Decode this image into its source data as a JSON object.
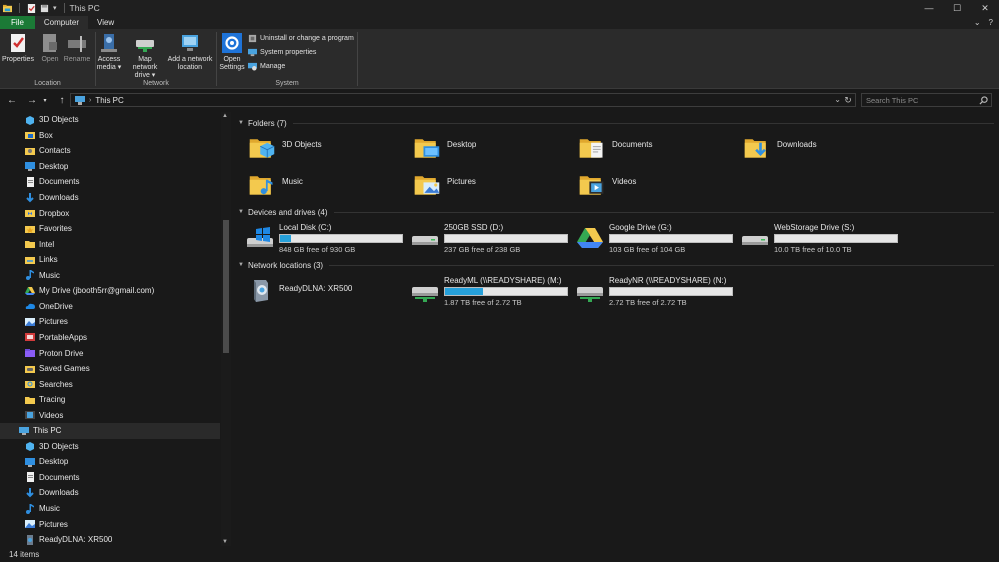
{
  "window": {
    "title": "This PC",
    "controls": {
      "minimize": "—",
      "maximize": "☐",
      "close": "✕"
    }
  },
  "ribbon_tabs": [
    {
      "label": "File"
    },
    {
      "label": "Computer"
    },
    {
      "label": "View"
    }
  ],
  "ribbon": {
    "location": {
      "label": "Location",
      "buttons": [
        {
          "label": "Properties",
          "icon": "properties-icon"
        },
        {
          "label": "Open",
          "icon": "open-icon"
        },
        {
          "label": "Rename",
          "icon": "rename-icon"
        }
      ]
    },
    "network": {
      "label": "Network",
      "buttons": [
        {
          "label": "Access media ▾",
          "icon": "media-icon"
        },
        {
          "label": "Map network drive ▾",
          "icon": "network-drive-icon"
        },
        {
          "label": "Add a network location",
          "icon": "network-location-icon"
        }
      ]
    },
    "system": {
      "label": "System",
      "open_settings": "Open Settings",
      "items": [
        {
          "label": "Uninstall or change a program"
        },
        {
          "label": "System properties"
        },
        {
          "label": "Manage"
        }
      ]
    }
  },
  "address": {
    "path": "This PC",
    "search_placeholder": "Search This PC"
  },
  "navpane": {
    "items": [
      {
        "label": "3D Objects",
        "icon": "3d-objects-icon",
        "indent": 1
      },
      {
        "label": "Box",
        "icon": "box-icon",
        "indent": 1
      },
      {
        "label": "Contacts",
        "icon": "contacts-icon",
        "indent": 1
      },
      {
        "label": "Desktop",
        "icon": "desktop-icon",
        "indent": 1
      },
      {
        "label": "Documents",
        "icon": "documents-icon",
        "indent": 1
      },
      {
        "label": "Downloads",
        "icon": "downloads-icon",
        "indent": 1
      },
      {
        "label": "Dropbox",
        "icon": "dropbox-icon",
        "indent": 1
      },
      {
        "label": "Favorites",
        "icon": "favorites-icon",
        "indent": 1
      },
      {
        "label": "Intel",
        "icon": "folder-icon",
        "indent": 1
      },
      {
        "label": "Links",
        "icon": "links-icon",
        "indent": 1
      },
      {
        "label": "Music",
        "icon": "music-icon",
        "indent": 1
      },
      {
        "label": "My Drive (jbooth5rr@gmail.com)",
        "icon": "google-drive-icon",
        "indent": 1
      },
      {
        "label": "OneDrive",
        "icon": "onedrive-icon",
        "indent": 1
      },
      {
        "label": "Pictures",
        "icon": "pictures-icon",
        "indent": 1
      },
      {
        "label": "PortableApps",
        "icon": "portableapps-icon",
        "indent": 1
      },
      {
        "label": "Proton Drive",
        "icon": "proton-drive-icon",
        "indent": 1
      },
      {
        "label": "Saved Games",
        "icon": "saved-games-icon",
        "indent": 1
      },
      {
        "label": "Searches",
        "icon": "searches-icon",
        "indent": 1
      },
      {
        "label": "Tracing",
        "icon": "folder-icon",
        "indent": 1
      },
      {
        "label": "Videos",
        "icon": "videos-icon",
        "indent": 1
      },
      {
        "label": "This PC",
        "icon": "this-pc-icon",
        "indent": 0,
        "selected": true
      },
      {
        "label": "3D Objects",
        "icon": "3d-objects-icon",
        "indent": 1
      },
      {
        "label": "Desktop",
        "icon": "desktop-icon",
        "indent": 1
      },
      {
        "label": "Documents",
        "icon": "documents-icon",
        "indent": 1
      },
      {
        "label": "Downloads",
        "icon": "downloads-icon",
        "indent": 1
      },
      {
        "label": "Music",
        "icon": "music-icon",
        "indent": 1
      },
      {
        "label": "Pictures",
        "icon": "pictures-icon",
        "indent": 1
      },
      {
        "label": "ReadyDLNA: XR500",
        "icon": "media-server-icon",
        "indent": 1
      }
    ]
  },
  "folders": {
    "title": "Folders (7)",
    "items": [
      {
        "label": "3D Objects",
        "icon": "3d-objects-icon"
      },
      {
        "label": "Desktop",
        "icon": "desktop-icon"
      },
      {
        "label": "Documents",
        "icon": "documents-icon"
      },
      {
        "label": "Downloads",
        "icon": "downloads-icon"
      },
      {
        "label": "Music",
        "icon": "music-icon"
      },
      {
        "label": "Pictures",
        "icon": "pictures-icon"
      },
      {
        "label": "Videos",
        "icon": "videos-icon"
      }
    ]
  },
  "devices": {
    "title": "Devices and drives (4)",
    "items": [
      {
        "label": "Local Disk (C:)",
        "free": "848 GB free of 930 GB",
        "used_fraction": 0.088,
        "icon": "windows-drive-icon"
      },
      {
        "label": "250GB SSD (D:)",
        "free": "237 GB free of 238 GB",
        "used_fraction": 0.0,
        "icon": "drive-icon"
      },
      {
        "label": "Google Drive (G:)",
        "free": "103 GB free of 104 GB",
        "used_fraction": 0.0,
        "icon": "google-drive-icon"
      },
      {
        "label": "WebStorage Drive (S:)",
        "free": "10.0 TB free of 10.0 TB",
        "used_fraction": 0.0,
        "icon": "drive-icon"
      }
    ]
  },
  "network": {
    "title": "Network locations (3)",
    "items": [
      {
        "label": "ReadyDLNA: XR500",
        "icon": "media-server-icon",
        "has_bar": false
      },
      {
        "label": "ReadyML (\\\\READYSHARE) (M:)",
        "free": "1.87 TB free of 2.72 TB",
        "used_fraction": 0.31,
        "icon": "network-drive-icon",
        "has_bar": true
      },
      {
        "label": "ReadyNR (\\\\READYSHARE) (N:)",
        "free": "2.72 TB free of 2.72 TB",
        "used_fraction": 0.0,
        "icon": "network-drive-icon",
        "has_bar": true
      }
    ]
  },
  "status": {
    "count": "14 items"
  },
  "colors": {
    "accent": "#26a0da",
    "file_tab": "#1b7a36",
    "background": "#191919",
    "folder_yellow": "#f3c94e"
  }
}
